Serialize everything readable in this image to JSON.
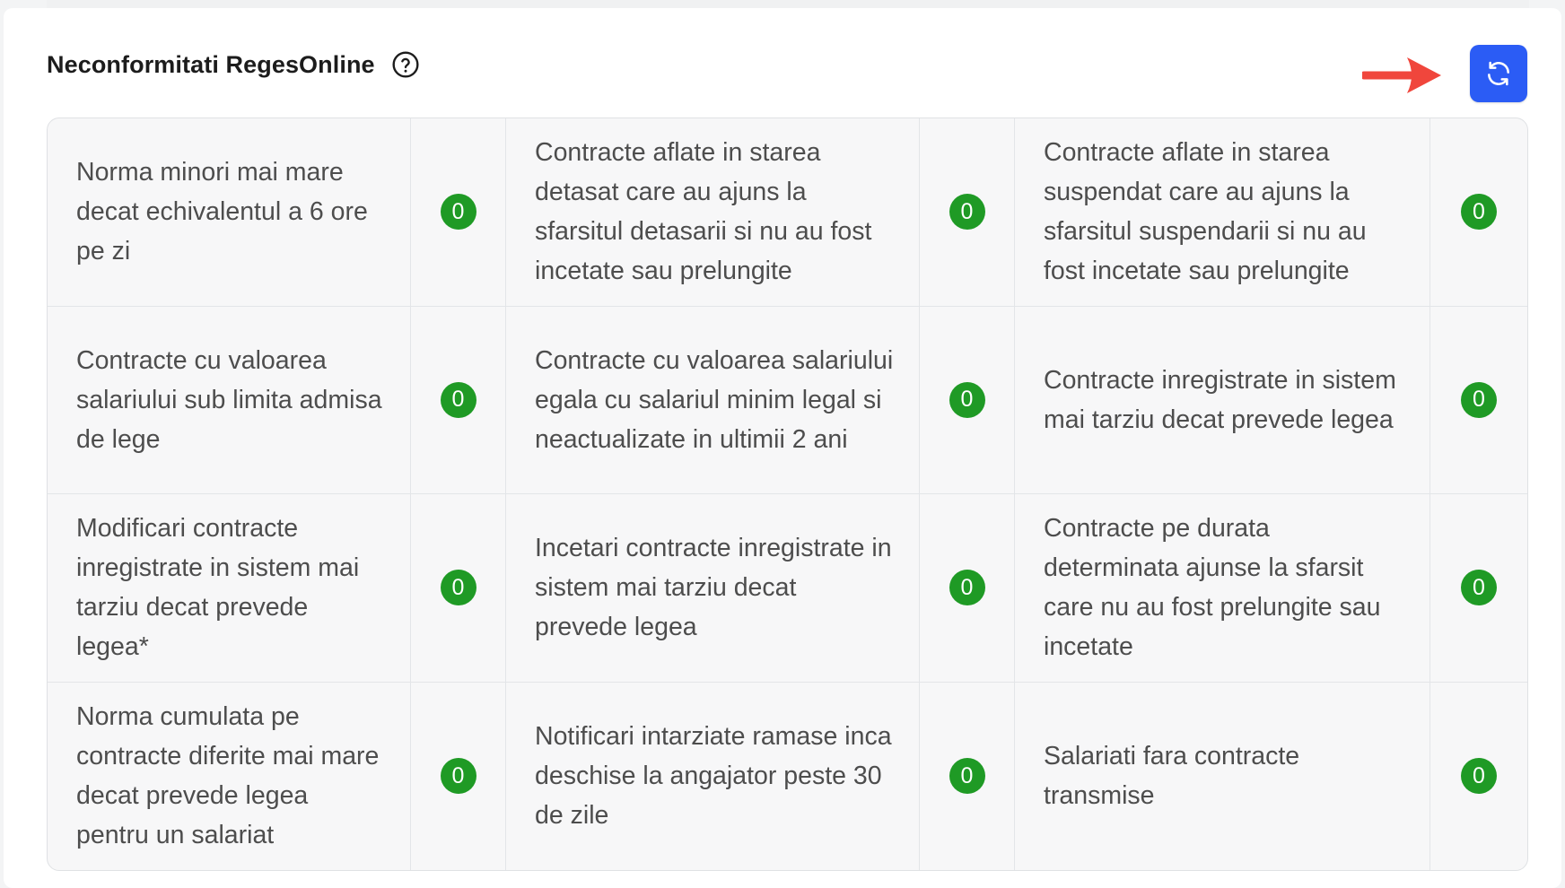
{
  "header": {
    "title": "Neconformitati RegesOnline"
  },
  "colors": {
    "accent": "#2b5cf5",
    "badge": "#1f9a25",
    "arrow": "#f0463c"
  },
  "icons": {
    "help": "help-circle-icon",
    "refresh": "refresh-icon",
    "annotation": "arrow-right-icon"
  },
  "rows": [
    [
      {
        "label": "Norma minori mai mare decat echivalentul a 6 ore pe zi",
        "count": "0"
      },
      {
        "label": "Contracte aflate in starea detasat care au ajuns la sfarsitul detasarii si nu au fost incetate sau prelungite",
        "count": "0"
      },
      {
        "label": "Contracte aflate in starea suspendat care au ajuns la sfarsitul suspendarii si nu au fost incetate sau prelungite",
        "count": "0"
      }
    ],
    [
      {
        "label": "Contracte cu valoarea salariului sub limita admisa de lege",
        "count": "0"
      },
      {
        "label": "Contracte cu valoarea salariului egala cu salariul minim legal si neactualizate in ultimii 2 ani",
        "count": "0"
      },
      {
        "label": "Contracte inregistrate in sistem mai tarziu decat prevede legea",
        "count": "0"
      }
    ],
    [
      {
        "label": "Modificari contracte inregistrate in sistem mai tarziu decat prevede legea*",
        "count": "0"
      },
      {
        "label": "Incetari contracte inregistrate in sistem mai tarziu decat prevede legea",
        "count": "0"
      },
      {
        "label": "Contracte pe durata determinata ajunse la sfarsit care nu au fost prelungite sau incetate",
        "count": "0"
      }
    ],
    [
      {
        "label": "Norma cumulata pe contracte diferite mai mare decat prevede legea pentru un salariat",
        "count": "0"
      },
      {
        "label": "Notificari intarziate ramase inca deschise la angajator peste 30 de zile",
        "count": "0"
      },
      {
        "label": "Salariati fara contracte transmise",
        "count": "0"
      }
    ]
  ]
}
